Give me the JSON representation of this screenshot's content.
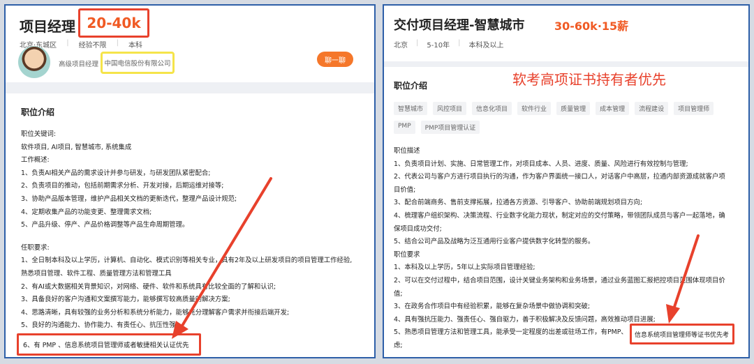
{
  "left": {
    "title": "项目经理",
    "salary": "20-40k",
    "meta": [
      "北京·东城区",
      "经验不限",
      "本科"
    ],
    "recruiter": "高级项目经理",
    "company": "中国电信股份有限公司",
    "chat_label": "聊一聊",
    "section_title": "职位介绍",
    "body": [
      "职位关键词:",
      "软件项目, AI项目, 智慧城市, 系统集成",
      "工作概述:",
      "1、负责AI相关产品的需求设计并参与研发，与研发团队紧密配合;",
      "2、负责项目的推动，包括前期需求分析、开发对接，后期运维对接等;",
      "3、协助产品版本管理，维护产品相关文档的更新迭代，整理产品设计规范;",
      "4、定期收集产品的功能变更、整理需求文档;",
      "5、产品升级、停产、产品价格调整等产品生命周期管理。",
      "",
      "任职要求:",
      "1、全日制本科及以上学历，计算机、自动化、模式识别等相关专业，具有2年及以上研发项目的项目管理工作经验,",
      "熟悉项目管理、软件工程、质量管理方法和管理工具",
      "2、有AI或大数据相关背景知识，对网络、硬件、软件和系统具有比较全面的了解和认识;",
      "3、具备良好的客户沟通和文案撰写能力，能够撰写较高质量的解决方案;",
      "4、思路清晰，具有较强的业务分析和系统分析能力，能够充分理解客户需求并衔接后端开发;",
      "5、良好的沟通能力、协作能力、有责任心、抗压性强"
    ],
    "highlight": "6、有 PMP 、信息系统项目管理师或者敏捷相关认证优先"
  },
  "right": {
    "title": "交付项目经理-智慧城市",
    "salary": "30-60k·15薪",
    "meta": [
      "北京",
      "5-10年",
      "本科及以上"
    ],
    "annotation": "软考高项证书持有者优先",
    "section_title": "职位介绍",
    "tags": [
      "智慧城市",
      "风控项目",
      "信息化项目",
      "软件行业",
      "质量管理",
      "成本管理",
      "流程建设",
      "项目管理师",
      "PMP",
      "PMP项目管理认证"
    ],
    "body": [
      "职位描述",
      "1、负责项目计划、实施、日常管理工作，对项目成本、人员、进度、质量、风险进行有效控制与管理;",
      "2、代表公司与客户方进行项目执行的沟通，作为客户界面统一接口人，对话客户中高层，拉通内部资源成就客户项",
      "目价值;",
      "3、配合前端商务、售前支撑拓展，拉通各方资源、引导客户、协助前端规划项目方向;",
      "4、梳理客户组织架构、决策流程、行业数字化能力现状，制定对应的交付策略，带领团队成员与客户一起落地，确",
      "保项目成功交付;",
      "5、结合公司产品及战略为泛互通用行业客户提供数字化转型的服务。",
      "职位要求",
      "1、本科及以上学历，5年以上实际项目管理经验;",
      "2、可以在交付过程中，结合项目范围，设计关键业务架构和业务场景，通过业务蓝图汇报把控项目范围体现项目价",
      "值;",
      "3、在政务合作项目中有经验积累，能够在复杂场景中做协调和突破;",
      "4、具有强抗压能力、强责任心、强自驱力，善于积极解决及反馈问题，高效推动项目进展;",
      "5、熟悉项目管理方法和管理工具，能承受一定程度的出差或驻场工作，有PMP、",
      "虑;"
    ],
    "highlight": "信息系统项目管理师等证书优先考"
  },
  "colors": {
    "accent": "#f05a24",
    "annotation": "#e8412c",
    "highlight_yellow": "#f5e44a",
    "frame": "#2d5fa8"
  }
}
